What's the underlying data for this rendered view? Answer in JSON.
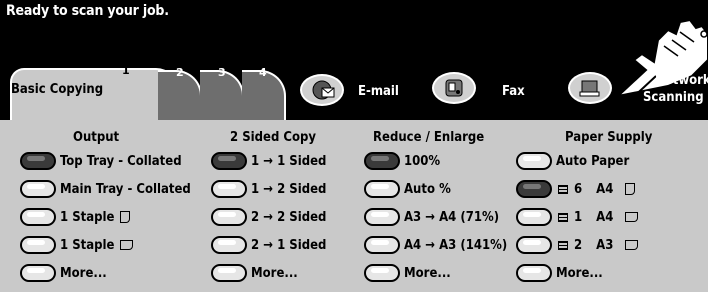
{
  "status": "Ready to scan your job.",
  "tabs": {
    "basic_copying": "Basic Copying",
    "numbers": [
      "1",
      "2",
      "3",
      "4"
    ],
    "email": "E-mail",
    "fax": "Fax",
    "network_scanning_line1": "Network",
    "network_scanning_line2": "Scanning"
  },
  "columns": {
    "output": {
      "header": "Output",
      "options": [
        "Top Tray - Collated",
        "Main Tray - Collated",
        "1 Staple",
        "1 Staple",
        "More..."
      ],
      "selected_index": 0
    },
    "two_sided": {
      "header": "2 Sided Copy",
      "options": [
        "1 → 1 Sided",
        "1 → 2 Sided",
        "2 → 2 Sided",
        "2 → 1 Sided",
        "More..."
      ],
      "selected_index": 0
    },
    "reduce": {
      "header": "Reduce / Enlarge",
      "options": [
        "100%",
        "Auto %",
        "A3 → A4 (71%)",
        "A4 → A3 (141%)",
        "More..."
      ],
      "selected_index": 0
    },
    "paper": {
      "header": "Paper Supply",
      "auto": "Auto Paper",
      "trays": [
        {
          "tray": "6",
          "size": "A4"
        },
        {
          "tray": "1",
          "size": "A4"
        },
        {
          "tray": "2",
          "size": "A3"
        }
      ],
      "more": "More...",
      "selected_index": 1
    }
  },
  "icons": [
    "email-icon",
    "fax-icon",
    "network-scanning-icon",
    "pointing-hand-icon"
  ]
}
